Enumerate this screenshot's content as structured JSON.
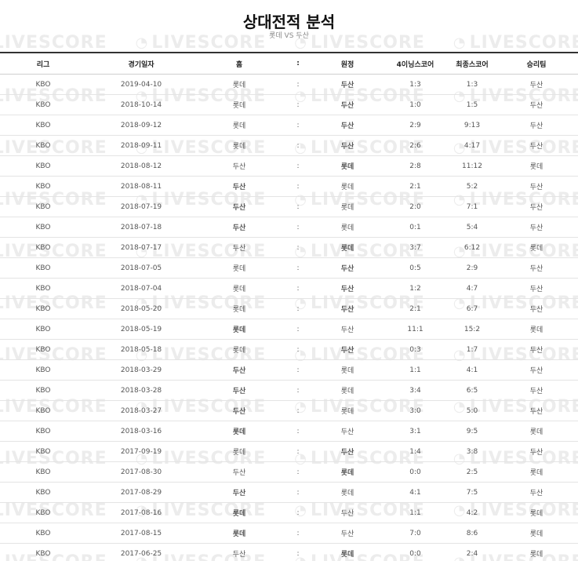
{
  "header": {
    "title": "상대전적 분석",
    "subtitle": "롯데 VS 두산"
  },
  "watermark": "LIVESCORE",
  "table": {
    "columns": [
      "리그",
      "경기일자",
      "홈",
      ":",
      "원정",
      "4이닝스코어",
      "최종스코어",
      "승리팀"
    ],
    "rows": [
      {
        "league": "KBO",
        "date": "2019-04-10",
        "home": "롯데",
        "sep": ":",
        "away": "두산",
        "score4": "1:3",
        "final": "1:3",
        "winner": "두산",
        "win_side": "away"
      },
      {
        "league": "KBO",
        "date": "2018-10-14",
        "home": "롯데",
        "sep": ":",
        "away": "두산",
        "score4": "1:0",
        "final": "1:5",
        "winner": "두산",
        "win_side": "away"
      },
      {
        "league": "KBO",
        "date": "2018-09-12",
        "home": "롯데",
        "sep": ":",
        "away": "두산",
        "score4": "2:9",
        "final": "9:13",
        "winner": "두산",
        "win_side": "away"
      },
      {
        "league": "KBO",
        "date": "2018-09-11",
        "home": "롯데",
        "sep": ":",
        "away": "두산",
        "score4": "2:6",
        "final": "4:17",
        "winner": "두산",
        "win_side": "away"
      },
      {
        "league": "KBO",
        "date": "2018-08-12",
        "home": "두산",
        "sep": ":",
        "away": "롯데",
        "score4": "2:8",
        "final": "11:12",
        "winner": "롯데",
        "win_side": "away"
      },
      {
        "league": "KBO",
        "date": "2018-08-11",
        "home": "두산",
        "sep": ":",
        "away": "롯데",
        "score4": "2:1",
        "final": "5:2",
        "winner": "두산",
        "win_side": "home"
      },
      {
        "league": "KBO",
        "date": "2018-07-19",
        "home": "두산",
        "sep": ":",
        "away": "롯데",
        "score4": "2:0",
        "final": "7:1",
        "winner": "두산",
        "win_side": "home"
      },
      {
        "league": "KBO",
        "date": "2018-07-18",
        "home": "두산",
        "sep": ":",
        "away": "롯데",
        "score4": "0:1",
        "final": "5:4",
        "winner": "두산",
        "win_side": "home"
      },
      {
        "league": "KBO",
        "date": "2018-07-17",
        "home": "두산",
        "sep": ":",
        "away": "롯데",
        "score4": "3:7",
        "final": "6:12",
        "winner": "롯데",
        "win_side": "away"
      },
      {
        "league": "KBO",
        "date": "2018-07-05",
        "home": "롯데",
        "sep": ":",
        "away": "두산",
        "score4": "0:5",
        "final": "2:9",
        "winner": "두산",
        "win_side": "away"
      },
      {
        "league": "KBO",
        "date": "2018-07-04",
        "home": "롯데",
        "sep": ":",
        "away": "두산",
        "score4": "1:2",
        "final": "4:7",
        "winner": "두산",
        "win_side": "away"
      },
      {
        "league": "KBO",
        "date": "2018-05-20",
        "home": "롯데",
        "sep": ":",
        "away": "두산",
        "score4": "2:1",
        "final": "6:7",
        "winner": "두산",
        "win_side": "away"
      },
      {
        "league": "KBO",
        "date": "2018-05-19",
        "home": "롯데",
        "sep": ":",
        "away": "두산",
        "score4": "11:1",
        "final": "15:2",
        "winner": "롯데",
        "win_side": "home"
      },
      {
        "league": "KBO",
        "date": "2018-05-18",
        "home": "롯데",
        "sep": ":",
        "away": "두산",
        "score4": "0:3",
        "final": "1:7",
        "winner": "두산",
        "win_side": "away"
      },
      {
        "league": "KBO",
        "date": "2018-03-29",
        "home": "두산",
        "sep": ":",
        "away": "롯데",
        "score4": "1:1",
        "final": "4:1",
        "winner": "두산",
        "win_side": "home"
      },
      {
        "league": "KBO",
        "date": "2018-03-28",
        "home": "두산",
        "sep": ":",
        "away": "롯데",
        "score4": "3:4",
        "final": "6:5",
        "winner": "두산",
        "win_side": "home"
      },
      {
        "league": "KBO",
        "date": "2018-03-27",
        "home": "두산",
        "sep": ":",
        "away": "롯데",
        "score4": "3:0",
        "final": "5:0",
        "winner": "두산",
        "win_side": "home"
      },
      {
        "league": "KBO",
        "date": "2018-03-16",
        "home": "롯데",
        "sep": ":",
        "away": "두산",
        "score4": "3:1",
        "final": "9:5",
        "winner": "롯데",
        "win_side": "home"
      },
      {
        "league": "KBO",
        "date": "2017-09-19",
        "home": "롯데",
        "sep": ":",
        "away": "두산",
        "score4": "1:4",
        "final": "3:8",
        "winner": "두산",
        "win_side": "away"
      },
      {
        "league": "KBO",
        "date": "2017-08-30",
        "home": "두산",
        "sep": ":",
        "away": "롯데",
        "score4": "0:0",
        "final": "2:5",
        "winner": "롯데",
        "win_side": "away"
      },
      {
        "league": "KBO",
        "date": "2017-08-29",
        "home": "두산",
        "sep": ":",
        "away": "롯데",
        "score4": "4:1",
        "final": "7:5",
        "winner": "두산",
        "win_side": "home"
      },
      {
        "league": "KBO",
        "date": "2017-08-16",
        "home": "롯데",
        "sep": ":",
        "away": "두산",
        "score4": "1:1",
        "final": "4:2",
        "winner": "롯데",
        "win_side": "home"
      },
      {
        "league": "KBO",
        "date": "2017-08-15",
        "home": "롯데",
        "sep": ":",
        "away": "두산",
        "score4": "7:0",
        "final": "8:6",
        "winner": "롯데",
        "win_side": "home"
      },
      {
        "league": "KBO",
        "date": "2017-06-25",
        "home": "두산",
        "sep": ":",
        "away": "롯데",
        "score4": "0:0",
        "final": "2:4",
        "winner": "롯데",
        "win_side": "away"
      }
    ]
  },
  "colors": {
    "win_team": "#2c2c8c",
    "text": "#555555",
    "header_border": "#333333",
    "watermark": "#ececec"
  }
}
